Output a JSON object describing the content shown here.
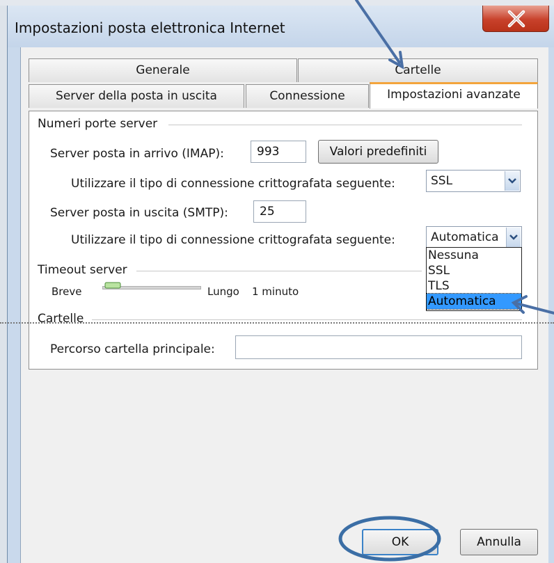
{
  "window": {
    "title": "Impostazioni posta elettronica Internet",
    "close_symbol": "X"
  },
  "tabs": {
    "row1": [
      {
        "label": "Generale"
      },
      {
        "label": "Cartelle"
      }
    ],
    "row2": [
      {
        "label": "Server della posta in uscita"
      },
      {
        "label": "Connessione"
      },
      {
        "label": "Impostazioni avanzate",
        "active": true
      }
    ]
  },
  "ports": {
    "group_title": "Numeri porte server",
    "incoming_label": "Server posta in arrivo (IMAP):",
    "incoming_value": "993",
    "defaults_button": "Valori predefiniti",
    "incoming_enc_label": "Utilizzare il tipo di connessione crittografata seguente:",
    "incoming_enc_value": "SSL",
    "outgoing_label": "Server posta in uscita (SMTP):",
    "outgoing_value": "25",
    "outgoing_enc_label": "Utilizzare il tipo di connessione crittografata seguente:",
    "outgoing_enc_value": "Automatica",
    "outgoing_enc_options": [
      "Nessuna",
      "SSL",
      "TLS",
      "Automatica"
    ]
  },
  "timeout": {
    "group_title": "Timeout server",
    "short_label": "Breve",
    "long_label": "Lungo",
    "value_label": "1 minuto"
  },
  "folders": {
    "group_title": "Cartelle",
    "root_label": "Percorso cartella principale:",
    "root_value": ""
  },
  "footer": {
    "ok": "OK",
    "cancel": "Annulla"
  },
  "icons": {
    "close": "close-icon",
    "dropdown": "chevron-down-icon"
  },
  "colors": {
    "active_tab_accent": "#f3a43c",
    "selection": "#3399ff",
    "annotation": "#4a6fa5"
  }
}
